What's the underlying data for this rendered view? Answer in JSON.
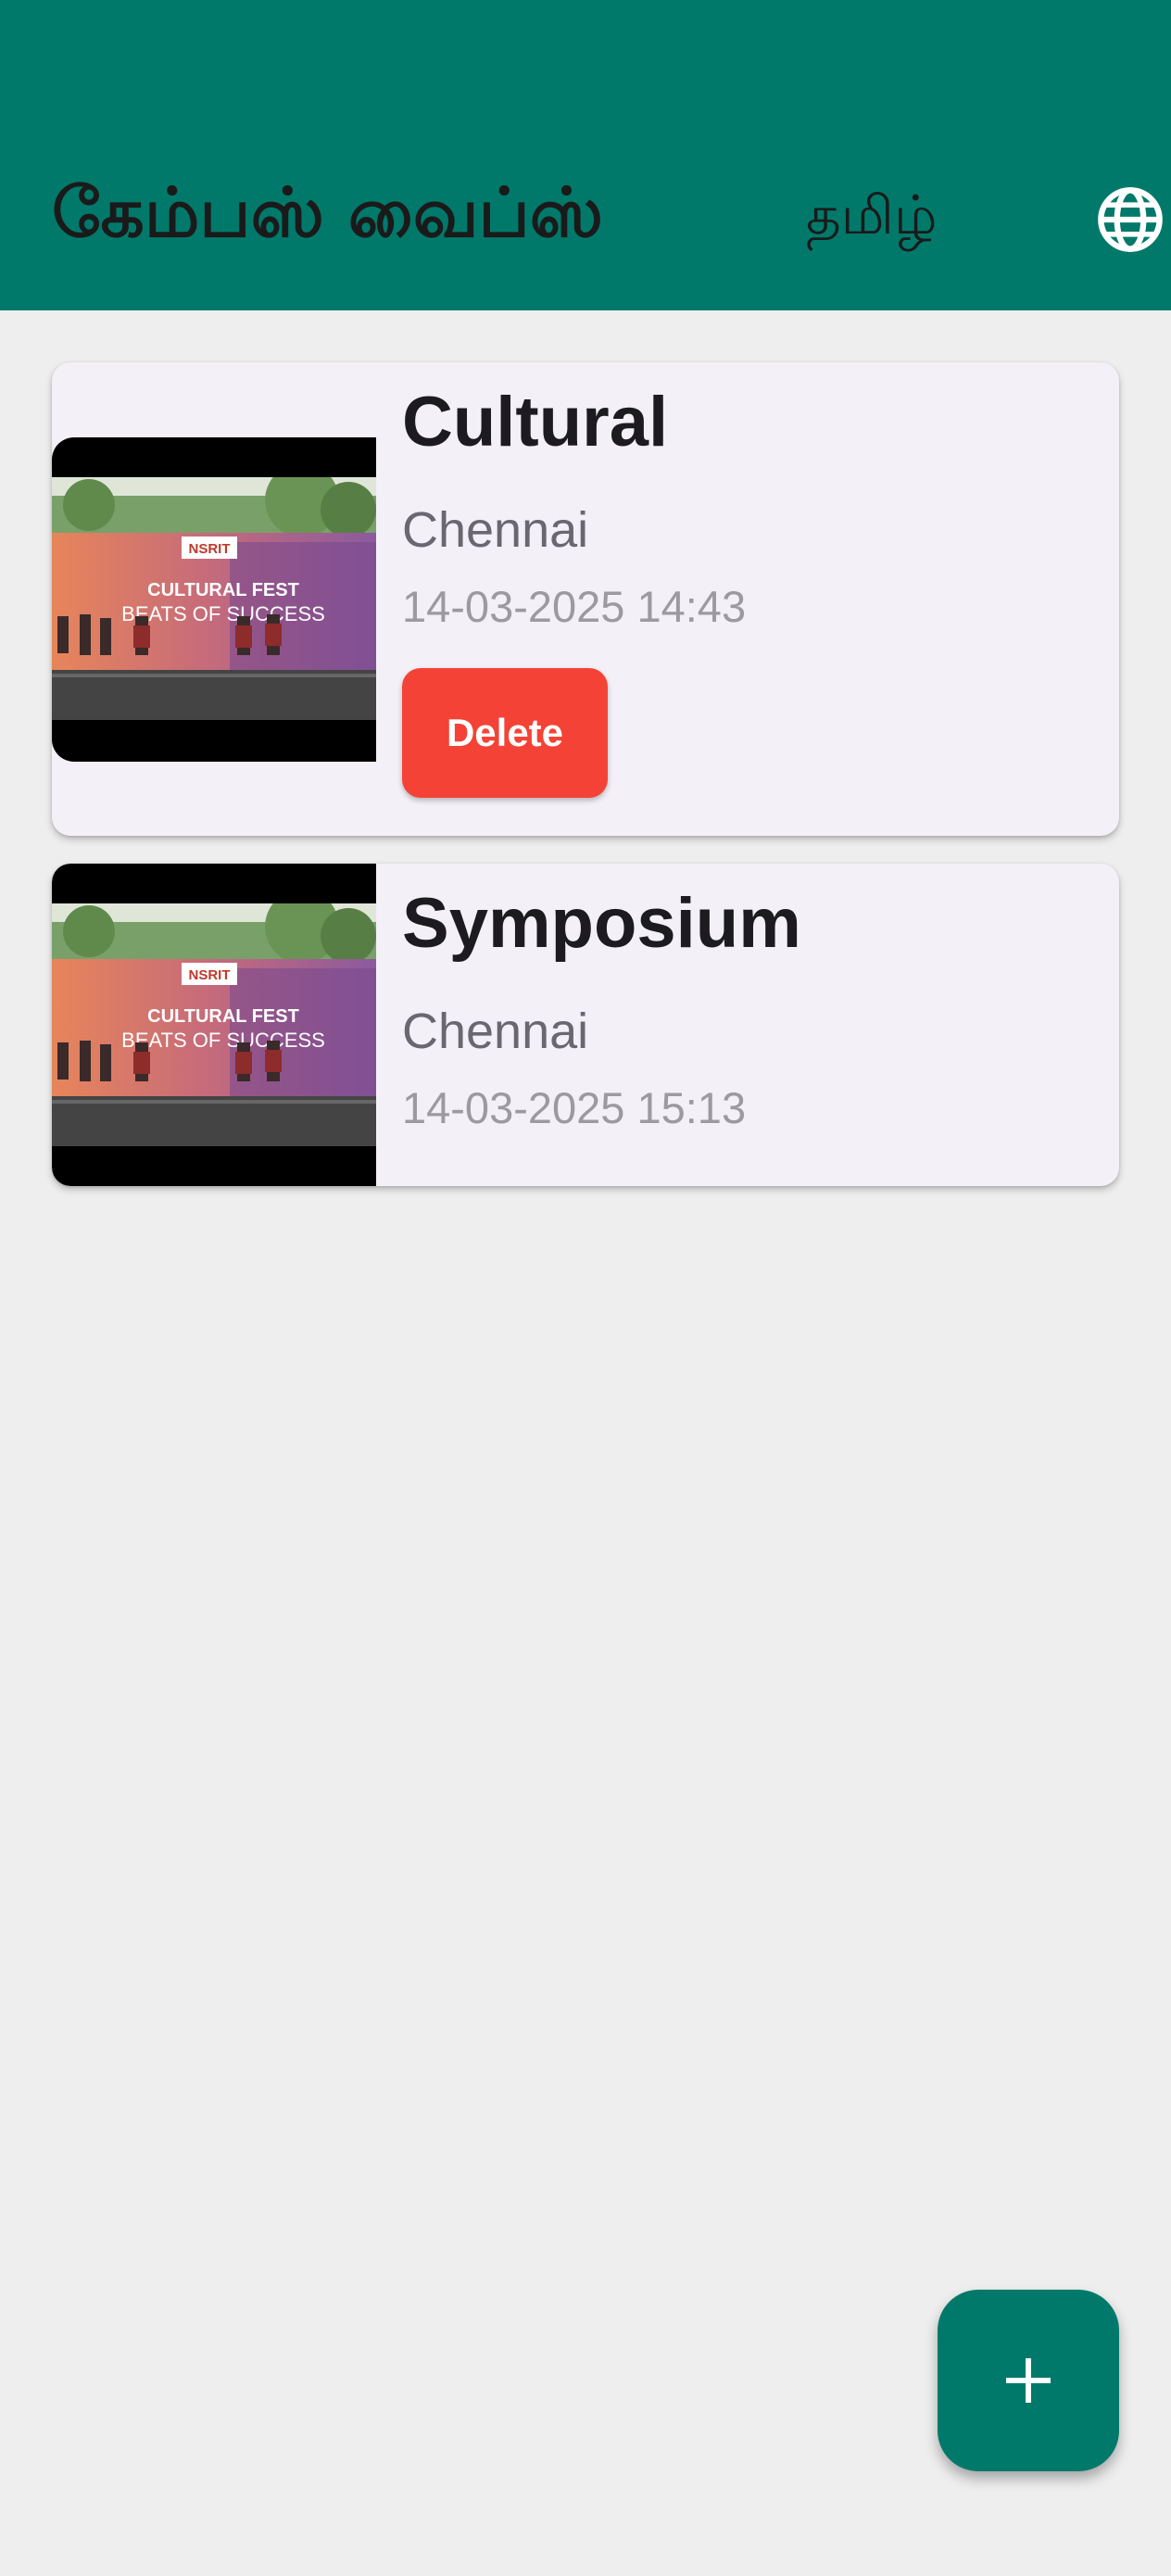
{
  "app_bar": {
    "title": "கேம்பஸ் வைப்ஸ்",
    "language_label": "தமிழ்",
    "language_icon": "globe-icon"
  },
  "events": [
    {
      "title": "Cultural",
      "location": "Chennai",
      "datetime": "14-03-2025 14:43",
      "delete_label": "Delete",
      "thumbnail_text": [
        "NSRIT",
        "CULTURAL FEST",
        "BEATS OF SUCCESS"
      ]
    },
    {
      "title": "Symposium",
      "location": "Chennai",
      "datetime": "14-03-2025 15:13",
      "thumbnail_text": [
        "NSRIT",
        "CULTURAL FEST",
        "BEATS OF SUCCESS"
      ]
    }
  ],
  "fab": {
    "icon": "plus-icon"
  },
  "colors": {
    "primary": "#00796b",
    "delete": "#f44336",
    "card": "#f4f0f7",
    "background": "#eeeeee"
  }
}
